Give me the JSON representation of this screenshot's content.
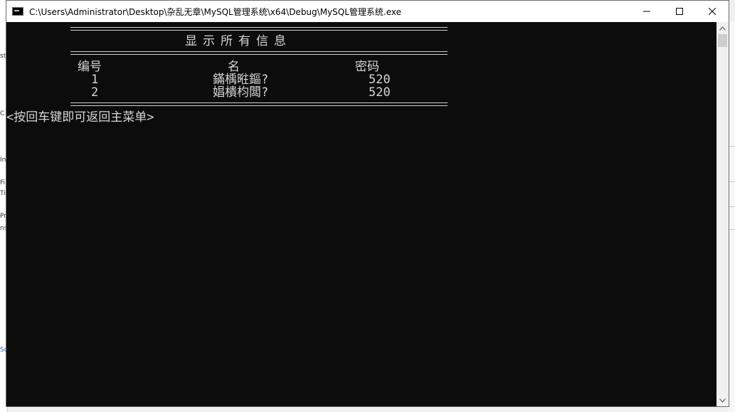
{
  "window": {
    "title": "C:\\Users\\Administrator\\Desktop\\杂乱无章\\MySQL管理系统\\x64\\Debug\\MySQL管理系统.exe",
    "controls": [
      "minimize-icon",
      "maximize-icon",
      "close-icon"
    ]
  },
  "console": {
    "heading": "显示所有信息",
    "headers": {
      "id": "编号",
      "name": "名",
      "password": "密码"
    },
    "rows": [
      {
        "id": "1",
        "name": "鏋楀暀鏂?",
        "password": "520"
      },
      {
        "id": "2",
        "name": "娼樻枃闆?",
        "password": "520"
      }
    ],
    "prompt": "<按回车键即可返回主菜单>"
  },
  "background": {
    "left_fragments": [
      "st",
      "C",
      "In",
      "Fi",
      "Ti",
      "Pr",
      "ns",
      "So"
    ]
  },
  "colors": {
    "console_bg": "#0c0c0c",
    "console_text": "#cccccc",
    "titlebar_bg": "#ffffff"
  }
}
